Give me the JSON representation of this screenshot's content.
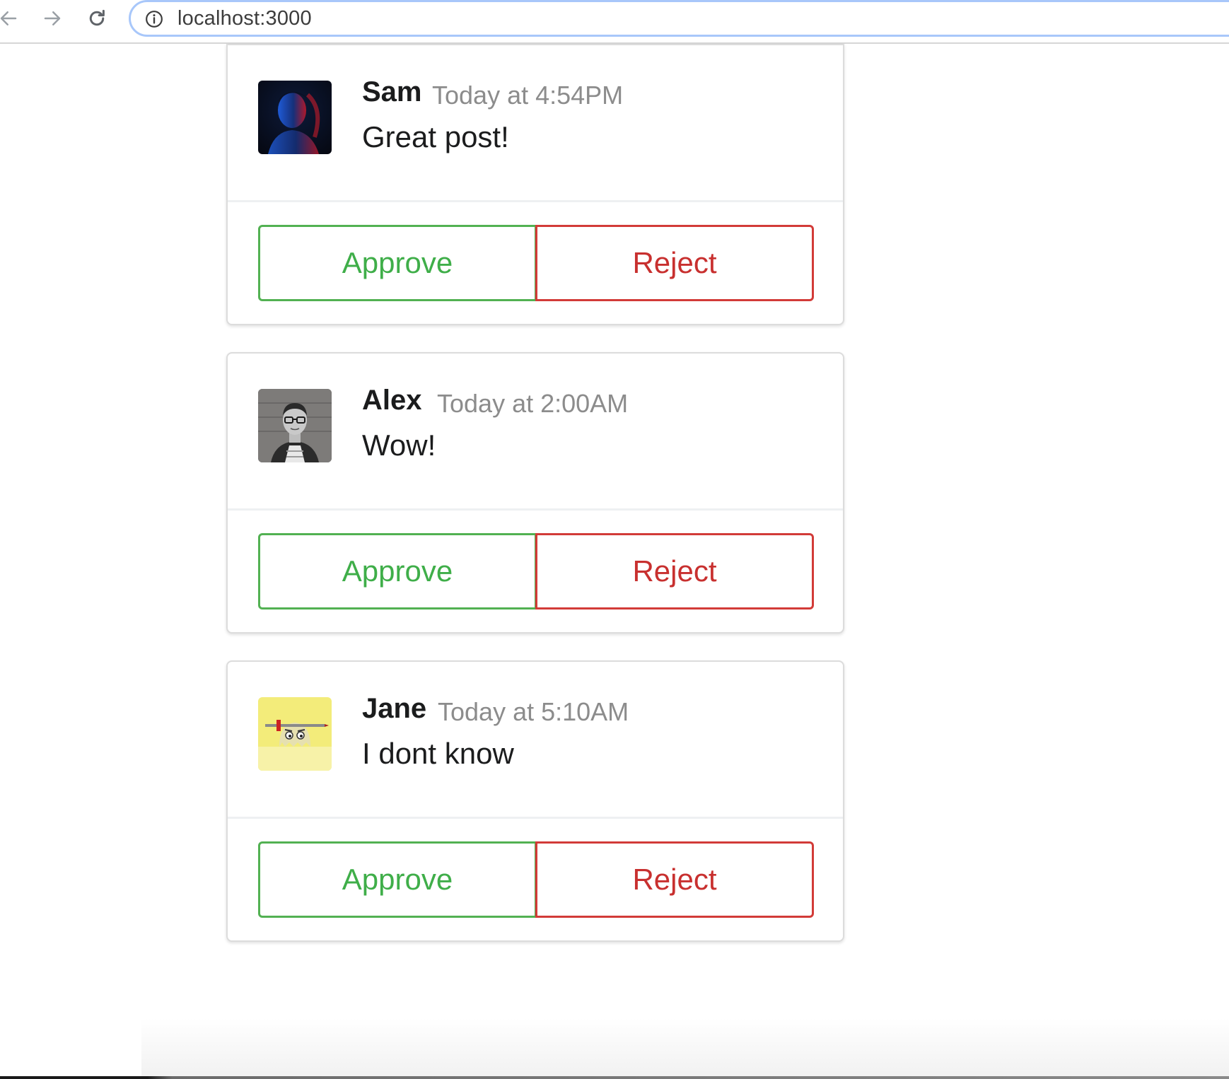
{
  "browser": {
    "url": "localhost:3000"
  },
  "comments": [
    {
      "author": "Sam",
      "time": "Today at 4:54PM",
      "text": "Great post!",
      "approve_label": "Approve",
      "reject_label": "Reject"
    },
    {
      "author": "Alex",
      "time": "Today at 2:00AM",
      "text": "Wow!",
      "approve_label": "Approve",
      "reject_label": "Reject"
    },
    {
      "author": "Jane",
      "time": "Today at 5:10AM",
      "text": "I dont know",
      "approve_label": "Approve",
      "reject_label": "Reject"
    }
  ],
  "colors": {
    "approve": "#3fae49",
    "reject": "#c8302f",
    "address_bar_border": "#a8c7fa"
  },
  "icons": {
    "back": "arrow-left-icon",
    "forward": "arrow-right-icon",
    "reload": "reload-icon",
    "site_info": "info-icon"
  }
}
